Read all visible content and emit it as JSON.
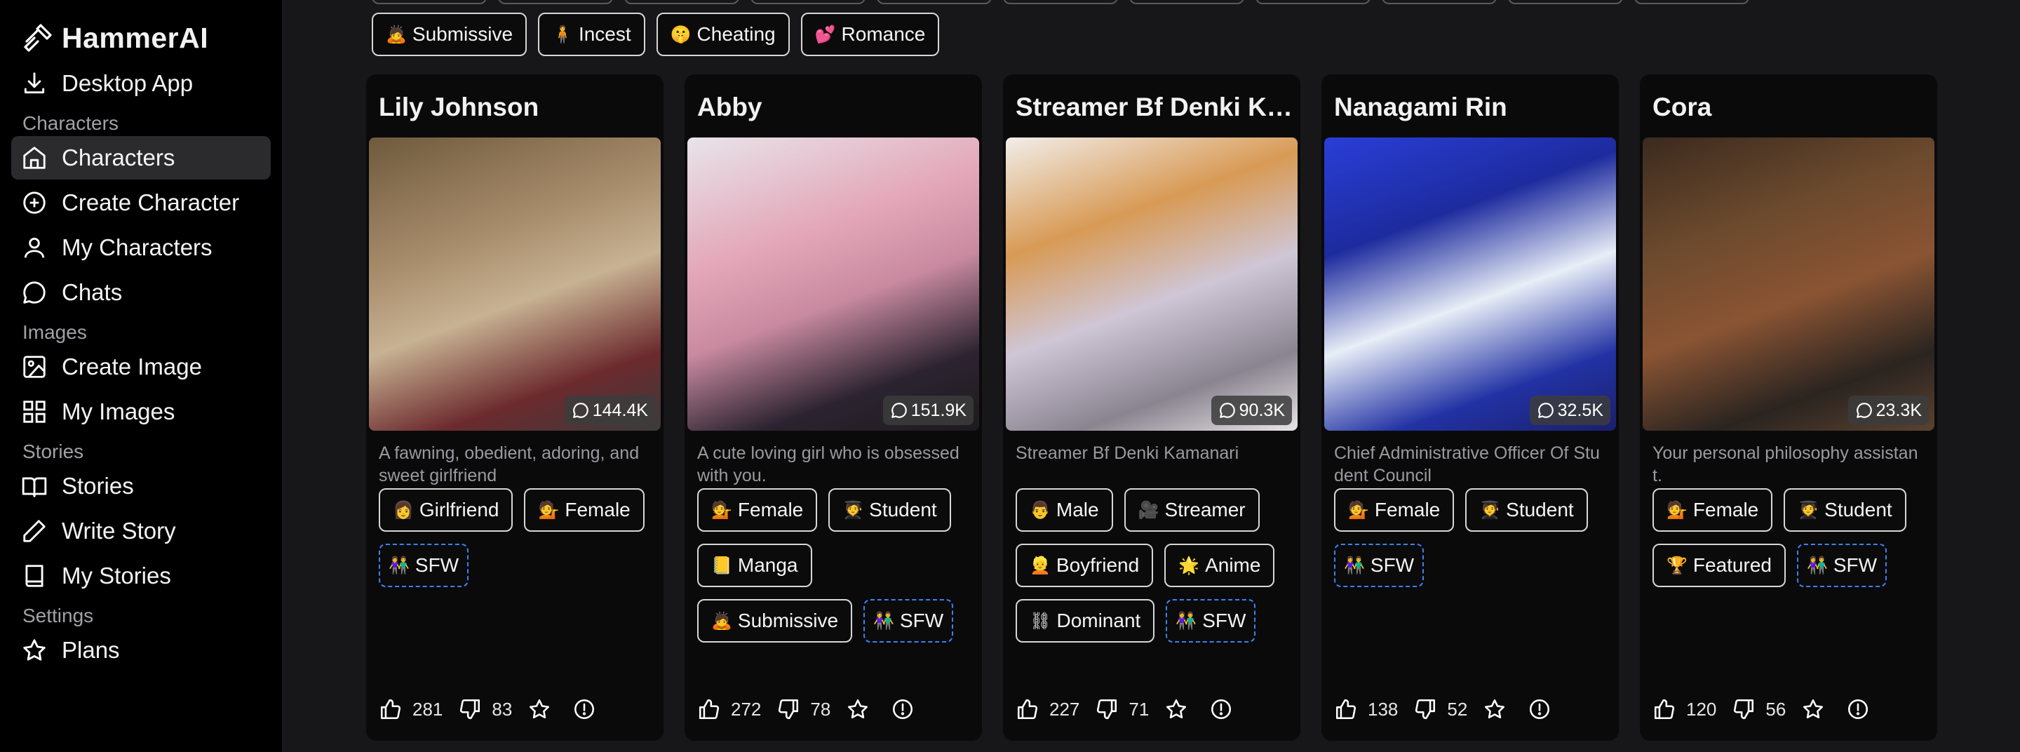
{
  "sidebar": {
    "brand": "HammerAI",
    "desktop_app": "Desktop App",
    "sections": {
      "characters": "Characters",
      "images": "Images",
      "stories": "Stories",
      "settings": "Settings"
    },
    "items": {
      "characters": "Characters",
      "create_character": "Create Character",
      "my_characters": "My Characters",
      "chats": "Chats",
      "create_image": "Create Image",
      "my_images": "My Images",
      "stories": "Stories",
      "write_story": "Write Story",
      "my_stories": "My Stories",
      "plans": "Plans"
    }
  },
  "top_tags": [
    {
      "emoji": "🙇",
      "label": "Submissive"
    },
    {
      "emoji": "🧍",
      "label": "Incest"
    },
    {
      "emoji": "🤫",
      "label": "Cheating"
    },
    {
      "emoji": "💕",
      "label": "Romance"
    }
  ],
  "cards": [
    {
      "name": "Lily Johnson",
      "chats": "144.4K",
      "description": "A fawning, obedient, adoring, and sweet girlfriend",
      "tags": [
        {
          "emoji": "👩",
          "label": "Girlfriend"
        },
        {
          "emoji": "💁",
          "label": "Female"
        },
        {
          "emoji": "👫",
          "label": "SFW",
          "dashed": true
        }
      ],
      "likes": "281",
      "dislikes": "83"
    },
    {
      "name": "Abby",
      "chats": "151.9K",
      "description": "A cute loving girl who is obsessed with you.",
      "tags": [
        {
          "emoji": "💁",
          "label": "Female"
        },
        {
          "emoji": "🧑‍🎓",
          "label": "Student"
        },
        {
          "emoji": "📒",
          "label": "Manga"
        },
        {
          "emoji": "🙇",
          "label": "Submissive"
        },
        {
          "emoji": "👫",
          "label": "SFW",
          "dashed": true
        }
      ],
      "likes": "272",
      "dislikes": "78"
    },
    {
      "name": "Streamer Bf Denki Kamanari",
      "chats": "90.3K",
      "description": "Streamer Bf Denki Kamanari",
      "tags": [
        {
          "emoji": "👨",
          "label": "Male"
        },
        {
          "emoji": "🎥",
          "label": "Streamer"
        },
        {
          "emoji": "👱",
          "label": "Boyfriend"
        },
        {
          "emoji": "🌟",
          "label": "Anime"
        },
        {
          "emoji": "⛓",
          "label": "Dominant"
        },
        {
          "emoji": "👫",
          "label": "SFW",
          "dashed": true
        }
      ],
      "likes": "227",
      "dislikes": "71"
    },
    {
      "name": "Nanagami Rin",
      "chats": "32.5K",
      "description": "Chief Administrative Officer Of Student Council",
      "tags": [
        {
          "emoji": "💁",
          "label": "Female"
        },
        {
          "emoji": "🧑‍🎓",
          "label": "Student"
        },
        {
          "emoji": "👫",
          "label": "SFW",
          "dashed": true
        }
      ],
      "likes": "138",
      "dislikes": "52"
    },
    {
      "name": "Cora",
      "chats": "23.3K",
      "description": "Your personal philosophy assistant.",
      "tags": [
        {
          "emoji": "💁",
          "label": "Female"
        },
        {
          "emoji": "🧑‍🎓",
          "label": "Student"
        },
        {
          "emoji": "🏆",
          "label": "Featured"
        },
        {
          "emoji": "👫",
          "label": "SFW",
          "dashed": true
        }
      ],
      "likes": "120",
      "dislikes": "56"
    }
  ],
  "colors": {
    "background": "#17171a",
    "sidebar": "#000000",
    "card": "#0a0a0b",
    "sfw_border": "#3b82f6"
  }
}
